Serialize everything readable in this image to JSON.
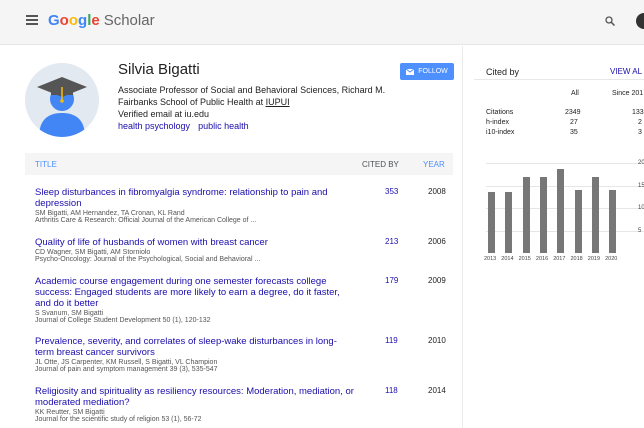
{
  "header": {
    "logo_text": [
      "G",
      "o",
      "o",
      "g",
      "l",
      "e"
    ],
    "product": "Scholar"
  },
  "profile": {
    "name": "Silvia Bigatti",
    "affiliation_prefix": "Associate Professor of Social and Behavioral Sciences, Richard M. Fairbanks School of Public Health at ",
    "affiliation_link": "IUPUI",
    "email": "Verified email at iu.edu",
    "interests": [
      "health psychology",
      "public health"
    ],
    "follow_label": "FOLLOW"
  },
  "table": {
    "col_title": "TITLE",
    "col_cited": "CITED BY",
    "col_year": "YEAR",
    "rows": [
      {
        "title": "Sleep disturbances in fibromyalgia syndrome: relationship to pain and depression",
        "authors": "SM Bigatti, AM Hernandez, TA Cronan, KL Rand",
        "venue": "Arthritis Care & Research: Official Journal of the American College of ...",
        "cited": "353",
        "year": "2008"
      },
      {
        "title": "Quality of life of husbands of women with breast cancer",
        "authors": "CD Wagner, SM Bigatti, AM Storniolo",
        "venue": "Psycho-Oncology: Journal of the Psychological, Social and Behavioral ...",
        "cited": "213",
        "year": "2006"
      },
      {
        "title": "Academic course engagement during one semester forecasts college success: Engaged students are more likely to earn a degree, do it faster, and do it better",
        "authors": "S Svanum, SM Bigatti",
        "venue": "Journal of College Student Development 50 (1), 120-132",
        "cited": "179",
        "year": "2009"
      },
      {
        "title": "Prevalence, severity, and correlates of sleep-wake disturbances in long-term breast cancer survivors",
        "authors": "JL Otte, JS Carpenter, KM Russell, S Bigatti, VL Champion",
        "venue": "Journal of pain and symptom management 39 (3), 535-547",
        "cited": "119",
        "year": "2010"
      },
      {
        "title": "Religiosity and spirituality as resiliency resources: Moderation, mediation, or moderated mediation?",
        "authors": "KK Reutter, SM Bigatti",
        "venue": "Journal for the scientific study of religion 53 (1), 56-72",
        "cited": "118",
        "year": "2014"
      }
    ]
  },
  "cited_by": {
    "title": "Cited by",
    "view_all": "VIEW AL",
    "col_all": "All",
    "col_since": "Since 201",
    "metrics": [
      {
        "label": "Citations",
        "all": "2349",
        "since": "133"
      },
      {
        "label": "h-index",
        "all": "27",
        "since": "2"
      },
      {
        "label": "i10-index",
        "all": "35",
        "since": "3"
      }
    ],
    "chart_data": {
      "type": "bar",
      "categories": [
        "2013",
        "2014",
        "2015",
        "2016",
        "2017",
        "2018",
        "2019",
        "2020"
      ],
      "values": [
        135,
        135,
        170,
        168,
        187,
        140,
        168,
        140
      ],
      "yticks": [
        "20",
        "15",
        "10",
        "5"
      ],
      "ylim": [
        0,
        200
      ]
    }
  }
}
